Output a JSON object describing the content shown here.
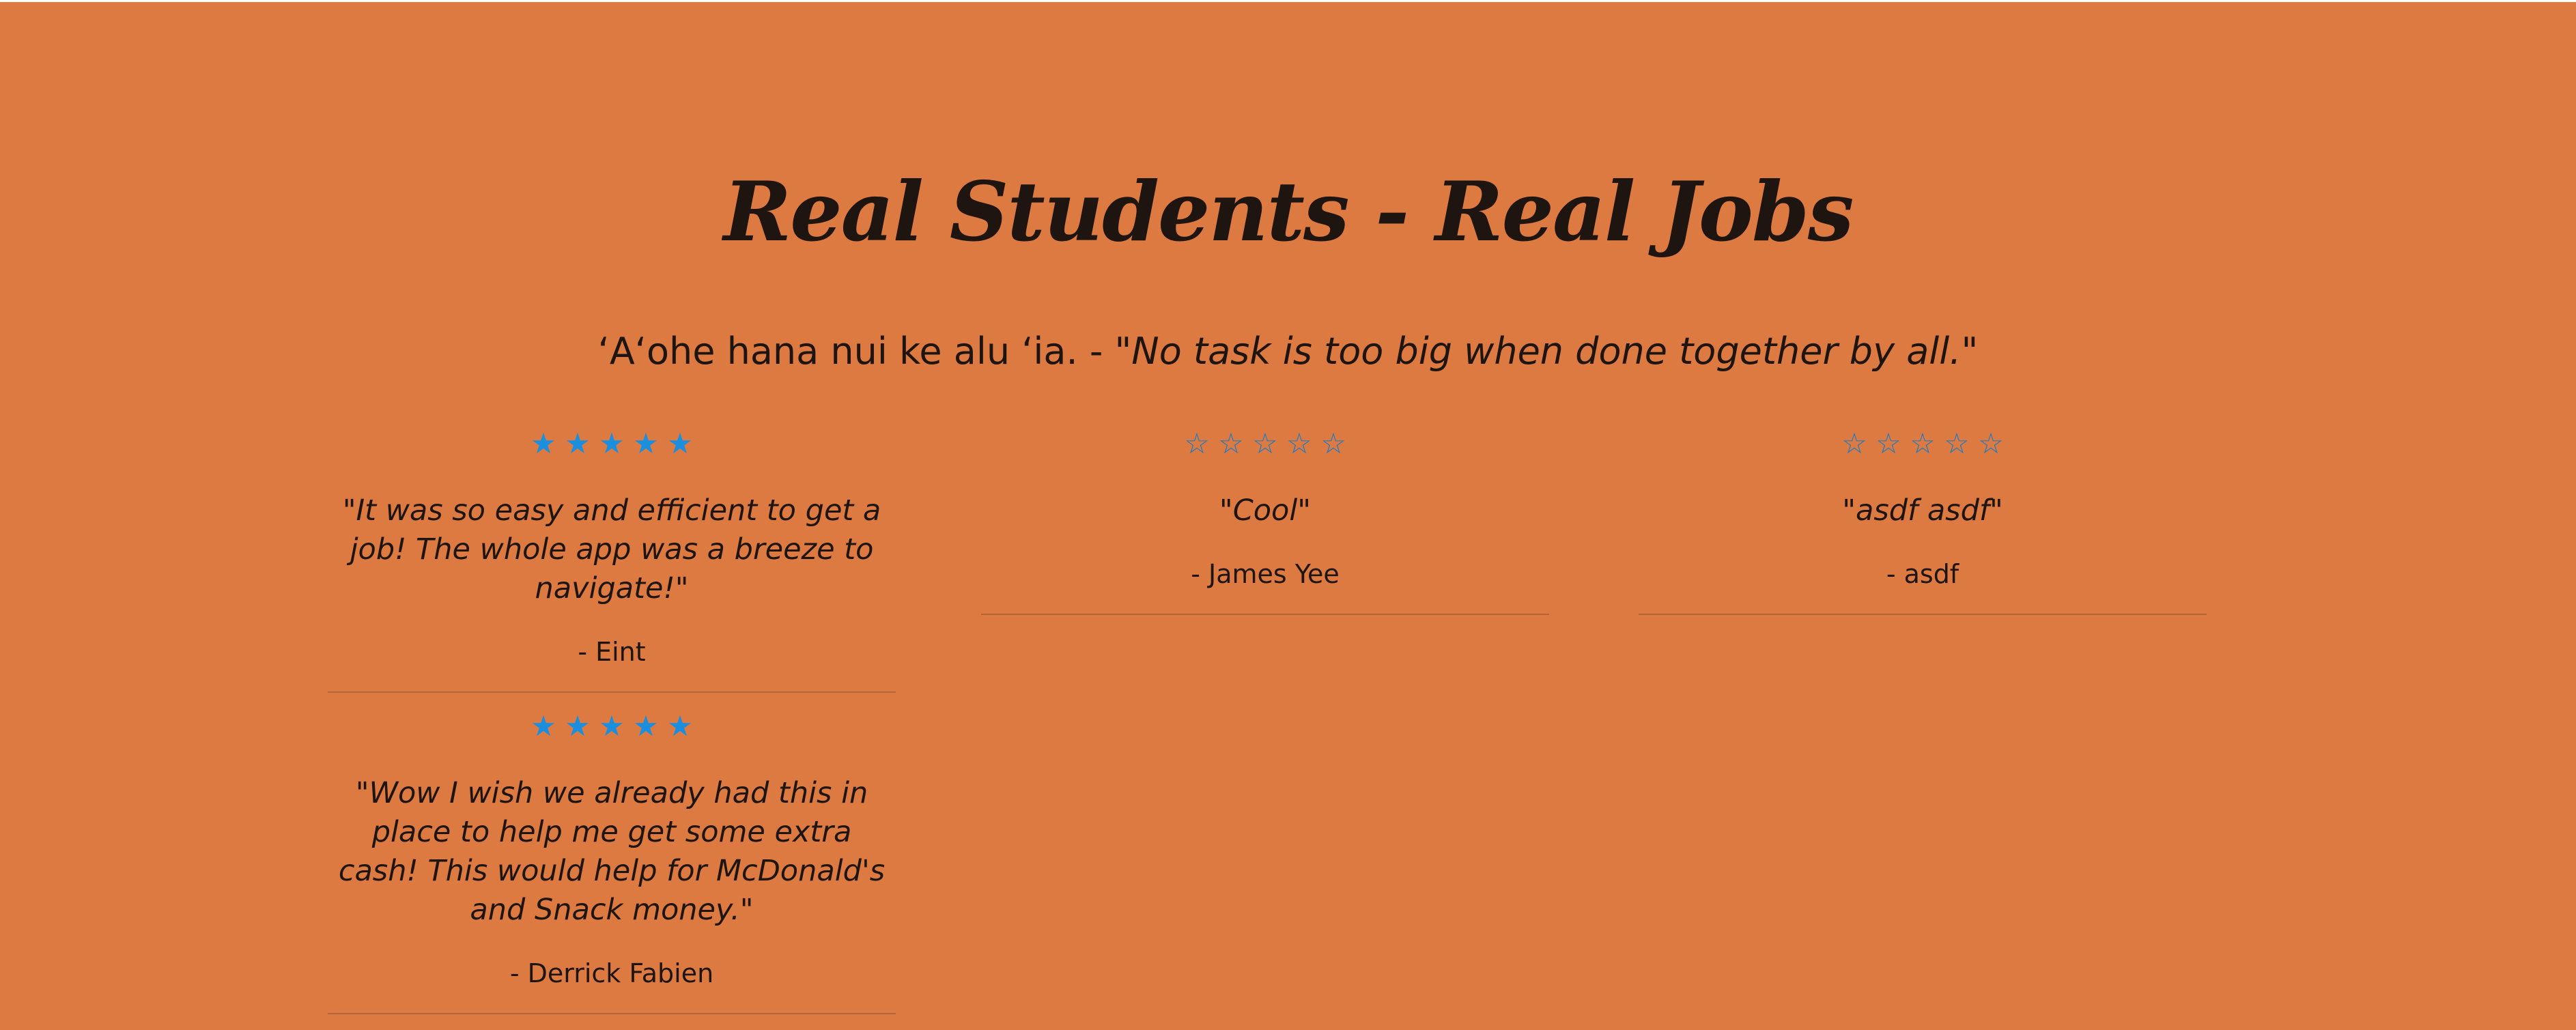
{
  "heading": "Real Students - Real Jobs",
  "subtitle": {
    "hawaiian": "ʻAʻohe hana nui ke alu ʻia. - ",
    "translation": "\"No task is too big when done together by all.\""
  },
  "colors": {
    "background": "#dc7a42",
    "text": "#1e1410",
    "star": "#1a8fe0"
  },
  "testimonials": [
    {
      "rating": 5,
      "quote": "\"It was so easy and efficient to get a job! The whole app was a breeze to navigate!\"",
      "author": "- Eint"
    },
    {
      "rating": 0,
      "quote": "\"Cool\"",
      "author": "- James Yee"
    },
    {
      "rating": 0,
      "quote": "\"asdf asdf\"",
      "author": "- asdf"
    },
    {
      "rating": 5,
      "quote": "\"Wow I wish we already had this in place to help me get some extra cash! This would help for McDonald's and Snack money.\"",
      "author": "- Derrick Fabien"
    }
  ]
}
